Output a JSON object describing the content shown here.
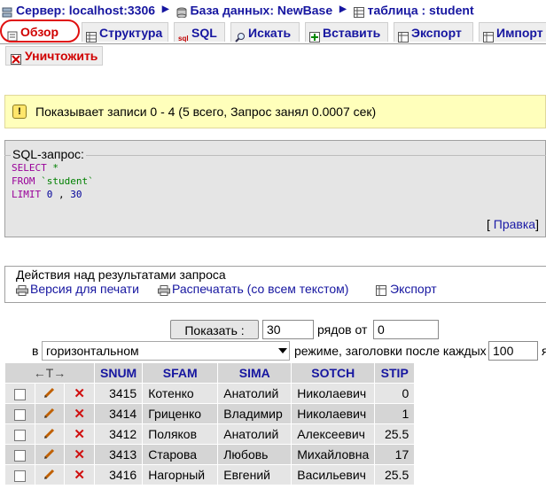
{
  "breadcrumb": {
    "server": "Сервер: localhost:3306",
    "database": "База данных: NewBase",
    "table": "таблица : student"
  },
  "tabs": {
    "browse": "Обзор",
    "structure": "Структура",
    "sql": "SQL",
    "search": "Искать",
    "insert": "Вставить",
    "export": "Экспорт",
    "import": "Импорт",
    "drop": "Уничтожить"
  },
  "notice": {
    "text": "Показывает записи 0 - 4 (5 всего, Запрос занял 0.0007 сек)"
  },
  "sql_query": {
    "legend": "SQL-запрос:",
    "select_kw": "SELECT",
    "select_arg": "*",
    "from_kw": "FROM",
    "from_arg": "`student`",
    "limit_kw": "LIMIT",
    "limit_a": "0",
    "limit_sep": ",",
    "limit_b": "30",
    "edit_link": "Правка",
    "edit_open": "[",
    "edit_close": "]"
  },
  "actions": {
    "legend": "Действия над результатами запроса",
    "print_view": "Версия для печати",
    "print_full": "Распечатать (со всем текстом)",
    "export": "Экспорт"
  },
  "navigation": {
    "show_button": "Показать :",
    "rows_value": "30",
    "rows_from_label": "рядов от",
    "from_value": "0",
    "in_label": "в",
    "mode_value": "горизонтальном",
    "mode_suffix": "режиме, заголовки после каждых",
    "repeat_value": "100",
    "trailing": "я"
  },
  "table": {
    "arrows": "←T→",
    "columns": [
      "SNUM",
      "SFAM",
      "SIMA",
      "SOTCH",
      "STIP"
    ],
    "rows": [
      [
        "3415",
        "Котенко",
        "Анатолий",
        "Николаевич",
        "0"
      ],
      [
        "3414",
        "Гриценко",
        "Владимир",
        "Николаевич",
        "1"
      ],
      [
        "3412",
        "Поляков",
        "Анатолий",
        "Алексеевич",
        "25.5"
      ],
      [
        "3413",
        "Старова",
        "Любовь",
        "Михайловна",
        "17"
      ],
      [
        "3416",
        "Нагорный",
        "Евгений",
        "Васильевич",
        "25.5"
      ]
    ]
  },
  "colors": {
    "link": "#1616a0",
    "danger": "#d00000",
    "notice_bg": "#ffffbb",
    "panel_bg": "#e5e5e5"
  },
  "icons": [
    "server-icon",
    "database-icon",
    "table-icon",
    "browse-icon",
    "structure-icon",
    "sql-icon",
    "search-icon",
    "insert-icon",
    "export-icon",
    "import-icon",
    "drop-icon",
    "info-icon",
    "print-icon",
    "edit-icon",
    "delete-icon",
    "checkbox"
  ]
}
